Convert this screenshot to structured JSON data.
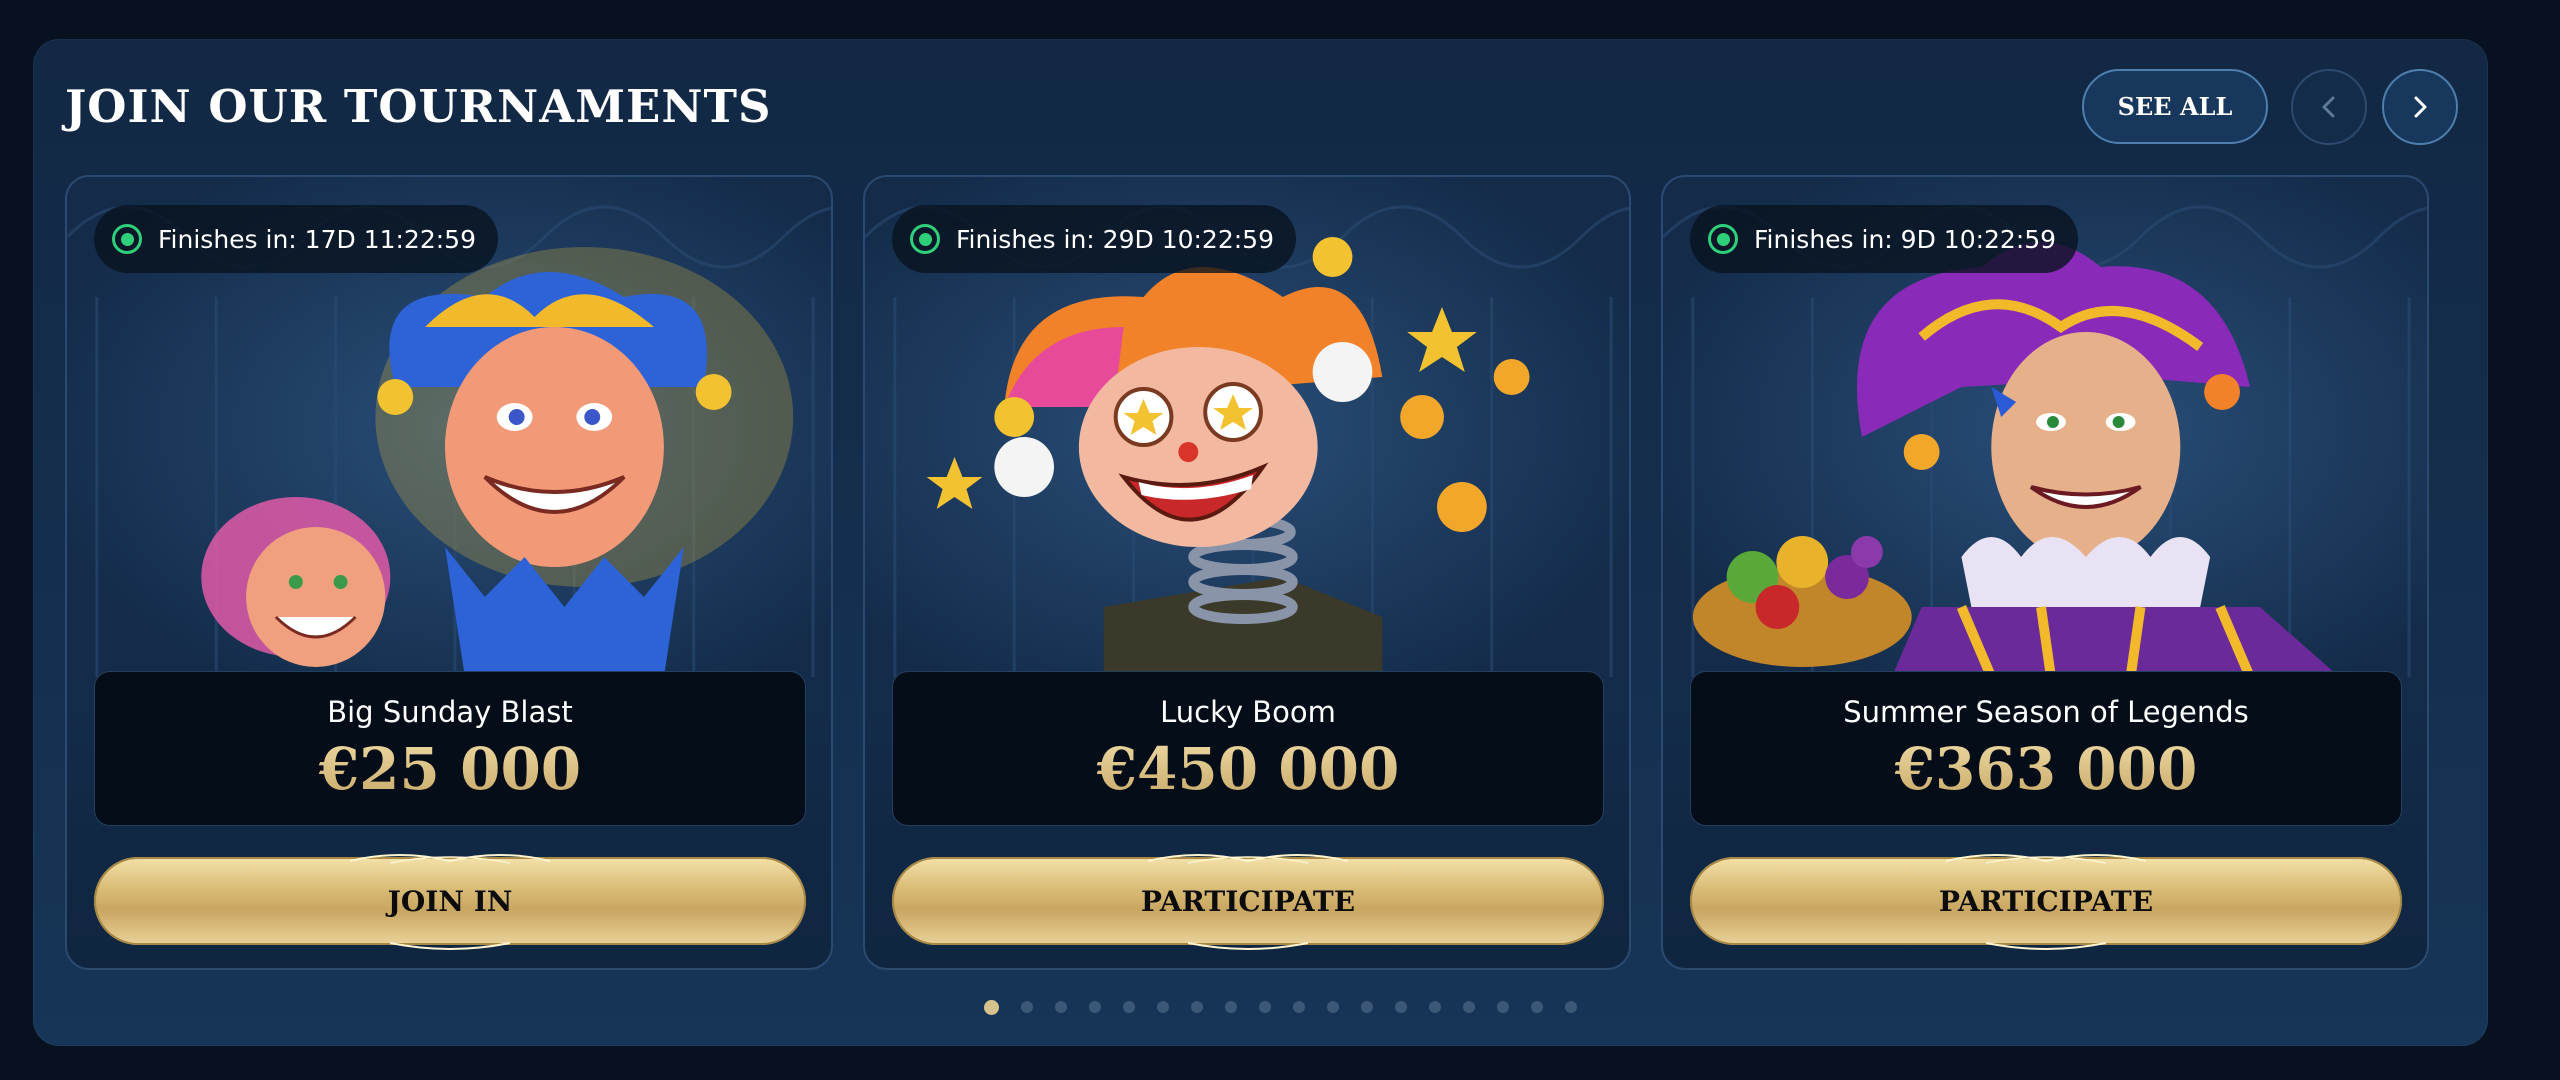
{
  "header": {
    "title": "JOIN OUR TOURNAMENTS",
    "see_all_label": "SEE ALL",
    "prev_icon": "chevron-left-icon",
    "next_icon": "chevron-right-icon"
  },
  "cards": [
    {
      "badge_text": "Finishes in: 17D 11:22:59",
      "name": "Big Sunday Blast",
      "prize": "€25 000",
      "cta_label": "JOIN IN",
      "art": "jester-duo-illustration"
    },
    {
      "badge_text": "Finishes in: 29D 10:22:59",
      "name": "Lucky Boom",
      "prize": "€450 000",
      "cta_label": "PARTICIPATE",
      "art": "jack-in-the-box-illustration"
    },
    {
      "badge_text": "Finishes in: 9D 10:22:59",
      "name": "Summer Season of Legends",
      "prize": "€363 000",
      "cta_label": "PARTICIPATE",
      "art": "purple-jester-illustration"
    }
  ],
  "pagination": {
    "total": 18,
    "active_index": 0
  },
  "colors": {
    "accent_gold": "#d9c083",
    "live_green": "#2fd07a",
    "panel_bg": "#14304f"
  }
}
